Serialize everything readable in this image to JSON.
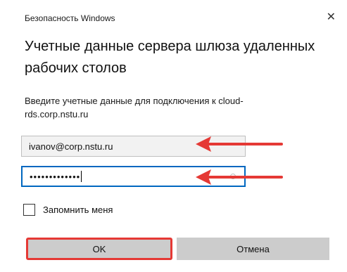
{
  "window": {
    "title": "Безопасность Windows",
    "close_glyph": "✕"
  },
  "dialog": {
    "heading": "Учетные данные сервера шлюза удаленных рабочих столов",
    "description": "Введите учетные данные для подключения к cloud-rds.corp.nstu.ru"
  },
  "fields": {
    "username_value": "ivanov@corp.nstu.ru",
    "password_masked": "•••••••••••••"
  },
  "remember": {
    "label": "Запомнить меня",
    "checked": false
  },
  "buttons": {
    "ok_label": "OK",
    "cancel_label": "Отмена"
  },
  "colors": {
    "annotation_red": "#e53935",
    "focus_blue": "#0067c0",
    "button_gray": "#cccccc"
  }
}
